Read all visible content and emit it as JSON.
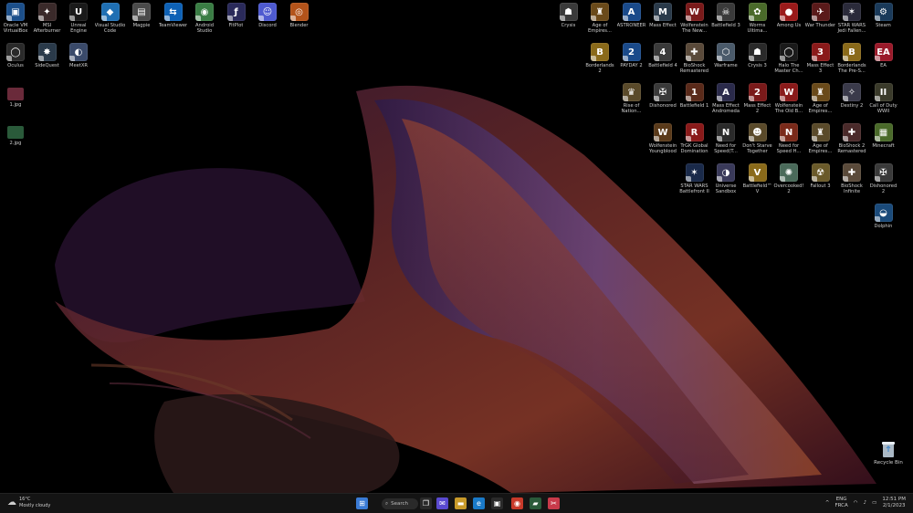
{
  "desktop": {
    "left_icons": [
      {
        "label": "Oracle VM VirtualBox",
        "color": "#1c4f8a",
        "glyph": "▣"
      },
      {
        "label": "MSI Afterburner",
        "color": "#3a2a2a",
        "glyph": "✦"
      },
      {
        "label": "Unreal Engine",
        "color": "#1a1a1a",
        "glyph": "U"
      },
      {
        "label": "Visual Studio Code",
        "color": "#1f6fb3",
        "glyph": "◆"
      },
      {
        "label": "Magpie",
        "color": "#4a4a4a",
        "glyph": "▤"
      },
      {
        "label": "TeamViewer",
        "color": "#0e61b5",
        "glyph": "⇆"
      },
      {
        "label": "Android Studio",
        "color": "#3a7d44",
        "glyph": "◉"
      },
      {
        "label": "FitPlot",
        "color": "#2a2a5a",
        "glyph": "ƒ"
      },
      {
        "label": "Discord",
        "color": "#4e5ad0",
        "glyph": "☺"
      },
      {
        "label": "Blender",
        "color": "#b3531a",
        "glyph": "◎"
      }
    ],
    "left_icons_row2": [
      {
        "label": "Oculus",
        "color": "#2a2a2a",
        "glyph": "◯"
      },
      {
        "label": "SideQuest",
        "color": "#2a3a4a",
        "glyph": "✸"
      },
      {
        "label": "MeetXR",
        "color": "#3a4a6a",
        "glyph": "◐"
      }
    ],
    "files": [
      {
        "label": "1.jpg",
        "color": "#6a2a3a"
      },
      {
        "label": "2.jpg",
        "color": "#2a5a3a"
      }
    ],
    "right_icons": [
      [
        {
          "label": "Crysis",
          "color": "#3a3a3a",
          "glyph": "☗"
        },
        {
          "label": "Age of Empires...",
          "color": "#6a4a1a",
          "glyph": "♜"
        },
        {
          "label": "ASTRONEER",
          "color": "#1a4a8a",
          "glyph": "A"
        },
        {
          "label": "Mass Effect",
          "color": "#2a3a4a",
          "glyph": "M"
        },
        {
          "label": "Wolfenstein The New...",
          "color": "#7a1a1a",
          "glyph": "W"
        },
        {
          "label": "Battlefield 3",
          "color": "#3a3a3a",
          "glyph": "☠"
        },
        {
          "label": "Worms Ultima...",
          "color": "#4a6a2a",
          "glyph": "✿"
        },
        {
          "label": "Among Us",
          "color": "#9a1a1a",
          "glyph": "●"
        },
        {
          "label": "War Thunder",
          "color": "#5a1a1a",
          "glyph": "✈"
        },
        {
          "label": "STAR WARS Jedi Fallen...",
          "color": "#2a2a3a",
          "glyph": "✶"
        },
        {
          "label": "Steam",
          "color": "#1a3a5a",
          "glyph": "⚙"
        }
      ],
      [
        {
          "label": "Borderlands 2",
          "color": "#8a6a1a",
          "glyph": "B"
        },
        {
          "label": "PAYDAY 2",
          "color": "#1a4a8a",
          "glyph": "2"
        },
        {
          "label": "Battlefield 4",
          "color": "#3a3a3a",
          "glyph": "4"
        },
        {
          "label": "BioShock Remastered",
          "color": "#5a4a3a",
          "glyph": "✚"
        },
        {
          "label": "Warframe",
          "color": "#4a5a6a",
          "glyph": "⬡"
        },
        {
          "label": "Crysis 3",
          "color": "#2a2a2a",
          "glyph": "☗"
        },
        {
          "label": "Halo The Master Ch...",
          "color": "#1a1a1a",
          "glyph": "◯"
        },
        {
          "label": "Mass Effect 3",
          "color": "#8a1a1a",
          "glyph": "3"
        },
        {
          "label": "Borderlands The Pre-S...",
          "color": "#8a6a1a",
          "glyph": "B"
        },
        {
          "label": "EA",
          "color": "#9a1a2a",
          "glyph": "EA"
        }
      ],
      [
        {
          "label": "Rise of Nation...",
          "color": "#5a4a2a",
          "glyph": "♛"
        },
        {
          "label": "Dishonored",
          "color": "#3a3a3a",
          "glyph": "✠"
        },
        {
          "label": "Battlefield 1",
          "color": "#5a2a1a",
          "glyph": "1"
        },
        {
          "label": "Mass Effect Andromeda",
          "color": "#2a2a4a",
          "glyph": "A"
        },
        {
          "label": "Mass Effect 2",
          "color": "#7a1a1a",
          "glyph": "2"
        },
        {
          "label": "Wolfenstein The Old B...",
          "color": "#8a1a1a",
          "glyph": "W"
        },
        {
          "label": "Age of Empires...",
          "color": "#6a4a1a",
          "glyph": "♜"
        },
        {
          "label": "Destiny 2",
          "color": "#3a3a4a",
          "glyph": "✧"
        },
        {
          "label": "Call of Duty WWII",
          "color": "#3a3a2a",
          "glyph": "II"
        }
      ],
      [
        {
          "label": "Wolfenstein Youngblood",
          "color": "#5a3a1a",
          "glyph": "W"
        },
        {
          "label": "TrGK Global Domination",
          "color": "#8a1a1a",
          "glyph": "R"
        },
        {
          "label": "Need for Speed(T...",
          "color": "#2a2a2a",
          "glyph": "N"
        },
        {
          "label": "Don't Starve Together",
          "color": "#5a4a2a",
          "glyph": "☻"
        },
        {
          "label": "Need for Speed H...",
          "color": "#7a2a1a",
          "glyph": "N"
        },
        {
          "label": "Age of Empires...",
          "color": "#5a4a2a",
          "glyph": "♜"
        },
        {
          "label": "BioShock 2 Remastered",
          "color": "#4a2a2a",
          "glyph": "✚"
        },
        {
          "label": "Minecraft",
          "color": "#4a6a2a",
          "glyph": "▦"
        }
      ],
      [
        {
          "label": "STAR WARS Battlefront II",
          "color": "#1a2a4a",
          "glyph": "✶"
        },
        {
          "label": "Universe Sandbox",
          "color": "#3a3a5a",
          "glyph": "◑"
        },
        {
          "label": "Battlefield™ V",
          "color": "#8a6a1a",
          "glyph": "V"
        },
        {
          "label": "Overcooked! 2",
          "color": "#4a6a5a",
          "glyph": "✺"
        },
        {
          "label": "Fallout 3",
          "color": "#6a5a2a",
          "glyph": "☢"
        },
        {
          "label": "BioShock Infinite",
          "color": "#5a4a3a",
          "glyph": "✚"
        },
        {
          "label": "Dishonored 2",
          "color": "#3a3a3a",
          "glyph": "✠"
        }
      ],
      [
        {
          "label": "Dolphin",
          "color": "#1a4a7a",
          "glyph": "◒"
        }
      ]
    ],
    "recycle_bin_label": "Recycle Bin"
  },
  "taskbar": {
    "weather_temp": "16°C",
    "weather_desc": "Mostly cloudy",
    "search_label": "Search",
    "lang_top": "ENG",
    "lang_bottom": "FRCA",
    "time": "12:51 PM",
    "date": "2/1/2023",
    "chevron": "^",
    "apps": [
      {
        "name": "windows-start",
        "color": "#3a7bd5",
        "glyph": "⊞"
      },
      {
        "name": "task-view",
        "color": "#2a2a2a",
        "glyph": "❐"
      },
      {
        "name": "chat",
        "color": "#5a4ad0",
        "glyph": "✉"
      },
      {
        "name": "file-explorer",
        "color": "#c89a2a",
        "glyph": "▬"
      },
      {
        "name": "edge",
        "color": "#1a7ac8",
        "glyph": "e"
      },
      {
        "name": "store",
        "color": "#2a2a2a",
        "glyph": "▣"
      },
      {
        "name": "chrome",
        "color": "#c83a2a",
        "glyph": "◉"
      },
      {
        "name": "terminal",
        "color": "#2a5a3a",
        "glyph": "▰"
      },
      {
        "name": "snipping-tool",
        "color": "#c83a4a",
        "glyph": "✂"
      }
    ]
  }
}
